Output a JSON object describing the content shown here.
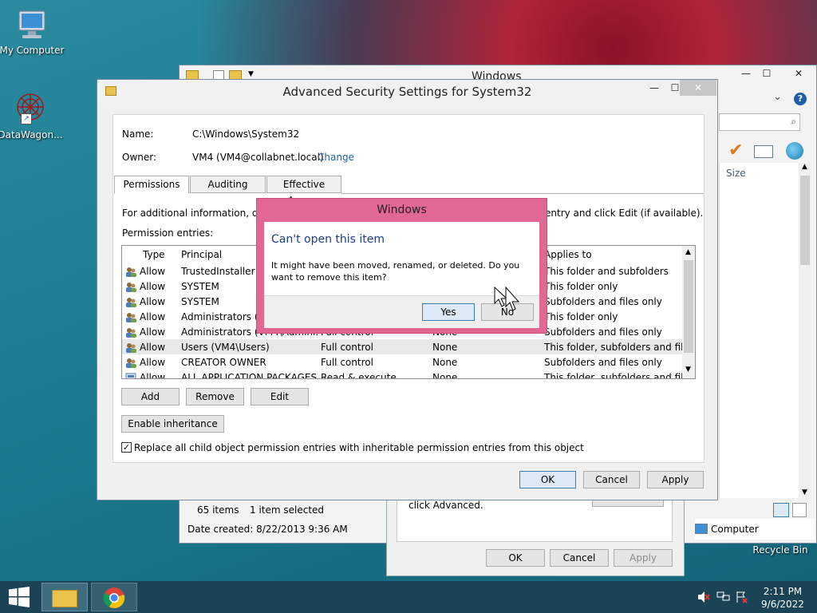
{
  "desktop": {
    "icons": [
      {
        "label": "My Computer",
        "icon": "computer-icon"
      },
      {
        "label": "DataWagon...",
        "icon": "datawagon-icon"
      },
      {
        "label": "Recycle Bin",
        "icon": "recycle-bin-icon"
      }
    ]
  },
  "explorer": {
    "title": "Windows",
    "column_size": "Size",
    "status_items": "65 items",
    "status_selected": "1 item selected",
    "date_created": "Date created: 8/22/2013 9:36 AM",
    "nav_computer": "Computer"
  },
  "props": {
    "hint": "click Advanced.",
    "ok": "OK",
    "cancel": "Cancel",
    "apply": "Apply"
  },
  "adv": {
    "title": "Advanced Security Settings for System32",
    "name_label": "Name:",
    "name_value": "C:\\Windows\\System32",
    "owner_label": "Owner:",
    "owner_value": "VM4 (VM4@collabnet.local)",
    "change_link": "Change",
    "tabs": [
      "Permissions",
      "Auditing",
      "Effective Access"
    ],
    "info_left": "For additional information, doub",
    "info_right": "entry and click Edit (if available).",
    "entries_label": "Permission entries:",
    "columns": {
      "type": "Type",
      "principal": "Principal",
      "access": "",
      "inherited": "",
      "applies": "Applies to"
    },
    "rows": [
      {
        "type": "Allow",
        "principal": "TrustedInstaller",
        "access": "",
        "inherited": "",
        "applies": "This folder and subfolders"
      },
      {
        "type": "Allow",
        "principal": "SYSTEM",
        "access": "",
        "inherited": "",
        "applies": "This folder only"
      },
      {
        "type": "Allow",
        "principal": "SYSTEM",
        "access": "",
        "inherited": "",
        "applies": "Subfolders and files only"
      },
      {
        "type": "Allow",
        "principal": "Administrators (VI",
        "access": "",
        "inherited": "",
        "applies": "This folder only"
      },
      {
        "type": "Allow",
        "principal": "Administrators (VM4\\Admini...",
        "access": "Full control",
        "inherited": "None",
        "applies": "Subfolders and files only"
      },
      {
        "type": "Allow",
        "principal": "Users (VM4\\Users)",
        "access": "Full control",
        "inherited": "None",
        "applies": "This folder, subfolders and files"
      },
      {
        "type": "Allow",
        "principal": "CREATOR OWNER",
        "access": "Full control",
        "inherited": "None",
        "applies": "Subfolders and files only"
      },
      {
        "type": "Allow",
        "principal": "ALL APPLICATION PACKAGES",
        "access": "Read & execute",
        "inherited": "None",
        "applies": "This folder, subfolders and files"
      }
    ],
    "add": "Add",
    "remove": "Remove",
    "edit": "Edit",
    "enable_inheritance": "Enable inheritance",
    "replace_checkbox": "Replace all child object permission entries with inheritable permission entries from this object",
    "replace_checked": true,
    "ok": "OK",
    "cancel": "Cancel",
    "apply": "Apply"
  },
  "msg": {
    "title": "Windows",
    "heading": "Can't open this item",
    "body": "It might have been moved, renamed, or deleted. Do you want to remove this item?",
    "yes": "Yes",
    "no": "No"
  },
  "taskbar": {
    "time": "2:11 PM",
    "date": "9/6/2022"
  },
  "colors": {
    "accent_pink": "#e06893",
    "link_blue": "#1c5fa8",
    "taskbar": "#1a4456"
  }
}
